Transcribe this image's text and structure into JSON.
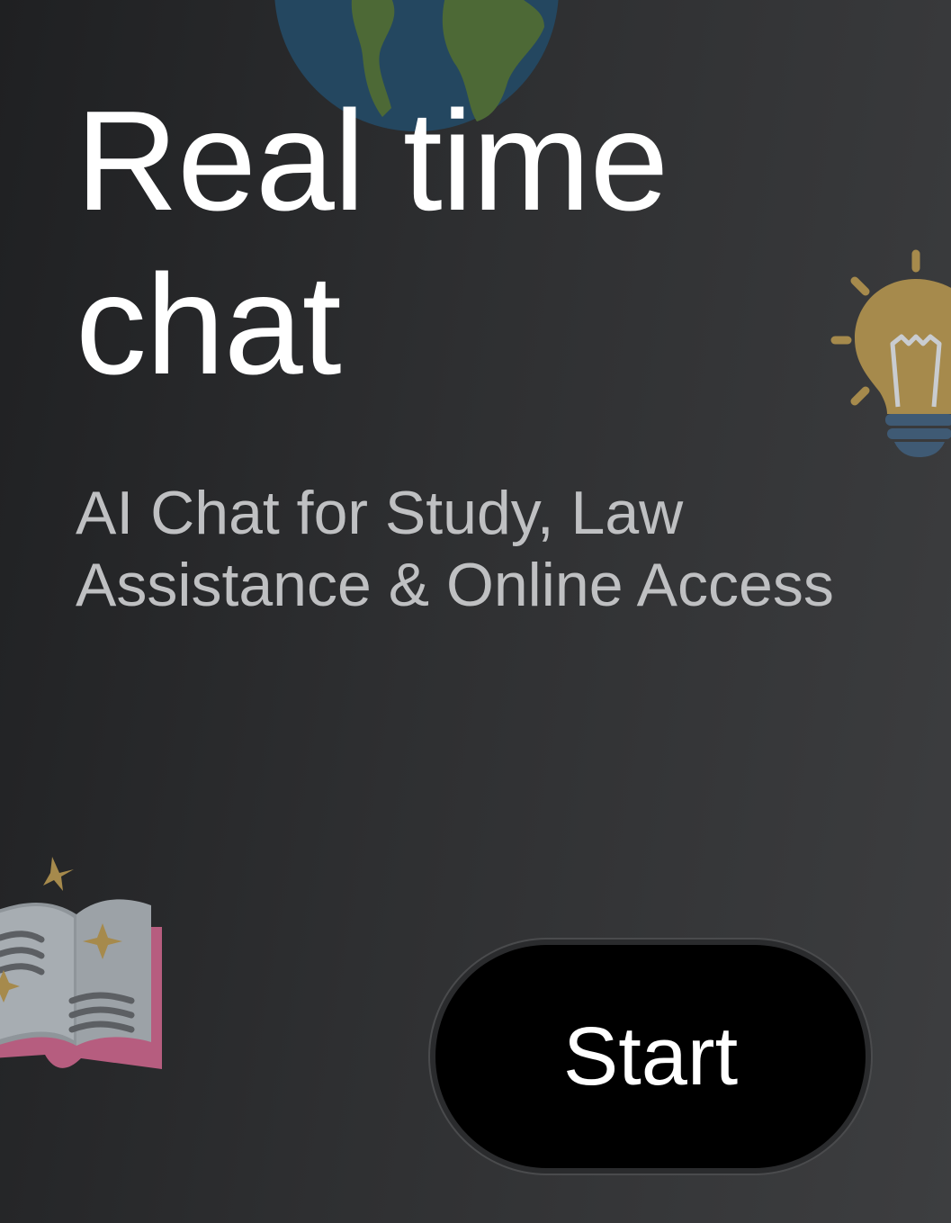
{
  "hero": {
    "title_line1": "Real time",
    "title_line2": "chat",
    "subtitle_line1": "AI Chat for Study, Law",
    "subtitle_line2": "Assistance & Online Access"
  },
  "actions": {
    "start_label": "Start"
  },
  "icons": {
    "top": "globe-icon",
    "right": "lightbulb-icon",
    "bottom_left": "open-book-icon"
  },
  "colors": {
    "background_dark": "#1f2022",
    "background_light": "#3d3e40",
    "title": "#ffffff",
    "subtitle": "#bfc0c2",
    "button": "#000000",
    "accent_gold": "#a68a4c"
  }
}
